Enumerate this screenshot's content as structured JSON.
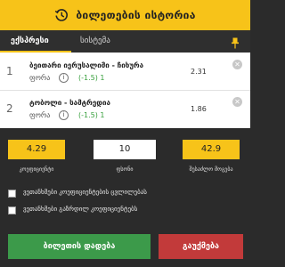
{
  "header": {
    "title": "ბილეთების ისტორია"
  },
  "tabs": [
    {
      "label": "ექსპრესი",
      "active": true
    },
    {
      "label": "სისტემა",
      "active": false
    }
  ],
  "bets": [
    {
      "index": "1",
      "match": "ბეითარი იერუსალიმი - ჩიხურა",
      "market": "ფორა",
      "info": "i",
      "selection": "(-1.5) 1",
      "odd": "2.31"
    },
    {
      "index": "2",
      "match": "ტობოლი - სამტრედია",
      "market": "ფორა",
      "info": "i",
      "selection": "(-1.5) 1",
      "odd": "1.86"
    }
  ],
  "totals": {
    "coef_value": "4.29",
    "coef_label": "კოეფიციენტი",
    "amount_value": "10",
    "amount_label": "ფსონი",
    "win_value": "42.9",
    "win_label": "შესაძლო მოგება"
  },
  "options": [
    {
      "label": "ვეთანხმები კოეფიციენტების ცვლილებას",
      "checked": false
    },
    {
      "label": "ვეთანხმები გაზრდილ კოეფიციენტებს",
      "checked": false
    }
  ],
  "buttons": {
    "place": "ბილეთის დადება",
    "cancel": "გაუქმება"
  },
  "colors": {
    "accent": "#f7c319",
    "place": "#3c9a4a",
    "cancel": "#c23a3a",
    "selection": "#3aa13f"
  }
}
